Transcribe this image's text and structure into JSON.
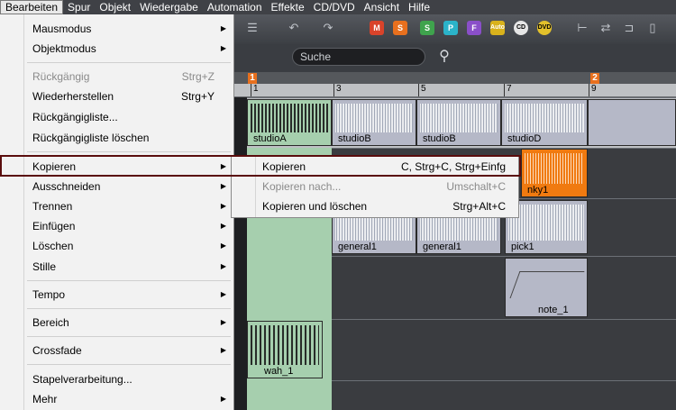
{
  "menubar": {
    "items": [
      "Bearbeiten",
      "Spur",
      "Objekt",
      "Wiedergabe",
      "Automation",
      "Effekte",
      "CD/DVD",
      "Ansicht",
      "Hilfe"
    ]
  },
  "toolbar": {
    "buttons": [
      "M",
      "S",
      "S",
      "P",
      "F",
      "Auto",
      "CD",
      "DVD"
    ],
    "colors": {
      "M": "#d9432a",
      "orange": "#e8701e",
      "green": "#3fa34d",
      "cyan": "#2bb3c9",
      "purple": "#8a4fc9",
      "yellow": "#d9b21c"
    }
  },
  "search": {
    "placeholder": "Suche",
    "icon": "search-icon"
  },
  "ruler": {
    "markers": [
      "1",
      "2"
    ],
    "ticks": [
      "1",
      "3",
      "5",
      "7",
      "9"
    ]
  },
  "clips": {
    "c1": "studioA",
    "c2": "studioB",
    "c3": "studioB",
    "c4": "studioD",
    "c5": "nky1",
    "c6": "general1",
    "c7": "general1",
    "c8": "pick1",
    "c9": "note_1",
    "c10": "wah_1"
  },
  "dropdown": {
    "items": [
      {
        "label": "Mausmodus",
        "shortcut": "",
        "submenu": true
      },
      {
        "label": "Objektmodus",
        "shortcut": "",
        "submenu": true
      },
      {
        "label": "Rückgängig",
        "shortcut": "Strg+Z",
        "disabled": true
      },
      {
        "label": "Wiederherstellen",
        "shortcut": "Strg+Y"
      },
      {
        "label": "Rückgängigliste..."
      },
      {
        "label": "Rückgängigliste löschen"
      },
      {
        "label": "Kopieren",
        "submenu": true,
        "selected": true
      },
      {
        "label": "Ausschneiden",
        "submenu": true
      },
      {
        "label": "Trennen",
        "submenu": true
      },
      {
        "label": "Einfügen",
        "submenu": true
      },
      {
        "label": "Löschen",
        "submenu": true
      },
      {
        "label": "Stille",
        "submenu": true
      },
      {
        "label": "Tempo",
        "submenu": true
      },
      {
        "label": "Bereich",
        "submenu": true
      },
      {
        "label": "Crossfade",
        "submenu": true
      },
      {
        "label": "Stapelverarbeitung..."
      },
      {
        "label": "Mehr",
        "submenu": true
      }
    ]
  },
  "submenu": {
    "items": [
      {
        "label": "Kopieren",
        "shortcut": "C, Strg+C, Strg+Einfg"
      },
      {
        "label": "Kopieren nach...",
        "shortcut": "Umschalt+C",
        "disabled": true
      },
      {
        "label": "Kopieren und löschen",
        "shortcut": "Strg+Alt+C"
      }
    ]
  }
}
